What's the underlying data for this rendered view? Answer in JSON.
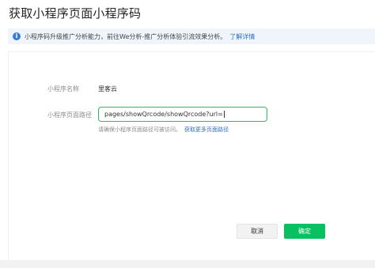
{
  "page": {
    "title": "获取小程序页面小程序码"
  },
  "notice": {
    "icon": "info-icon",
    "icon_glyph": "i",
    "text": "小程序码升级推广分析能力，前往We分析-推广分析体验引流效果分析。",
    "link": "了解详情"
  },
  "form": {
    "name_label": "小程序名称",
    "name_value": "里客云",
    "path_label": "小程序页面路径",
    "path_value": "pages/showQrcode/showQrcode?url=",
    "hint": "请确保小程序页面路径可被访问。",
    "hint_link": "获取更多页面路径"
  },
  "actions": {
    "cancel": "取消",
    "confirm": "确定"
  },
  "colors": {
    "accent": "#07c160",
    "link": "#2f6fc4",
    "notice_bg": "#f0f5fb",
    "info_icon": "#3a7bd5",
    "input_border": "#35b56a"
  }
}
